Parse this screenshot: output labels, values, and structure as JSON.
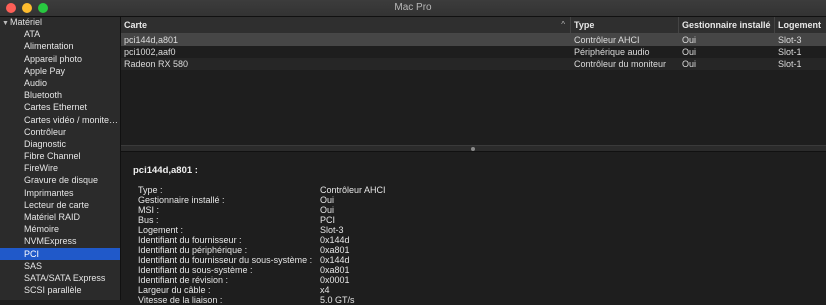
{
  "window": {
    "title": "Mac Pro"
  },
  "sidebar": {
    "group": "Matériel",
    "items": [
      "ATA",
      "Alimentation",
      "Appareil photo",
      "Apple Pay",
      "Audio",
      "Bluetooth",
      "Cartes Ethernet",
      "Cartes vidéo / monite…",
      "Contrôleur",
      "Diagnostic",
      "Fibre Channel",
      "FireWire",
      "Gravure de disque",
      "Imprimantes",
      "Lecteur de carte",
      "Matériel RAID",
      "Mémoire",
      "NVMExpress",
      "PCI",
      "SAS",
      "SATA/SATA Express",
      "SCSI parallèle"
    ],
    "selected_item": "PCI"
  },
  "table": {
    "columns": [
      "Carte",
      "Type",
      "Gestionnaire installé",
      "Logement"
    ],
    "sort_indicator": "^",
    "rows": [
      [
        "pci144d,a801",
        "Contrôleur AHCI",
        "Oui",
        "Slot-3"
      ],
      [
        "pci1002,aaf0",
        "Périphérique audio",
        "Oui",
        "Slot-1"
      ],
      [
        "Radeon RX 580",
        "Contrôleur du moniteur",
        "Oui",
        "Slot-1"
      ]
    ],
    "selected_row": 0
  },
  "detail": {
    "title": "pci144d,a801 :",
    "fields": [
      {
        "key": "Type :",
        "value": "Contrôleur AHCI"
      },
      {
        "key": "Gestionnaire installé :",
        "value": "Oui"
      },
      {
        "key": "MSI :",
        "value": "Oui"
      },
      {
        "key": "Bus :",
        "value": "PCI"
      },
      {
        "key": "Logement :",
        "value": "Slot-3"
      },
      {
        "key": "Identifiant du fournisseur :",
        "value": "0x144d"
      },
      {
        "key": "Identifiant du périphérique :",
        "value": "0xa801"
      },
      {
        "key": "Identifiant du fournisseur du sous-système :",
        "value": "0x144d"
      },
      {
        "key": "Identifiant du sous-système :",
        "value": "0xa801"
      },
      {
        "key": "Identifiant de révision :",
        "value": "0x0001"
      },
      {
        "key": "Largeur du câble :",
        "value": "x4"
      },
      {
        "key": "Vitesse de la liaison :",
        "value": "5.0 GT/s"
      }
    ]
  },
  "colors": {
    "selection": "#2059c9",
    "close": "#fe5f57",
    "minimize": "#febc2e",
    "zoom": "#28c840"
  }
}
